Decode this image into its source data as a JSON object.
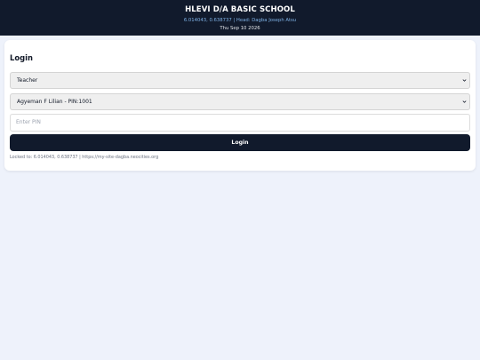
{
  "header": {
    "school_name": "HLEVI D/A BASIC SCHOOL",
    "meta": "6.014043, 0.638737 | Head: Dagba Joseph Atsu",
    "date": "Thu Sep 10 2026"
  },
  "login": {
    "title": "Login",
    "role_select": {
      "selected": "Teacher"
    },
    "teacher_select": {
      "selected": "Agyeman F Lilian - PIN:1001"
    },
    "pin_input": {
      "placeholder": "Enter PIN",
      "value": ""
    },
    "login_button_label": "Login",
    "footer_note": "Locked to: 6.014043, 0.638737 | https://my-site-dagba.neocities.org"
  },
  "colors": {
    "header_bg": "#111a2c",
    "page_bg": "#eef2fb",
    "accent_text": "#7fb2e6"
  },
  "icons": {
    "select_arrow": "chevron-down-icon"
  }
}
